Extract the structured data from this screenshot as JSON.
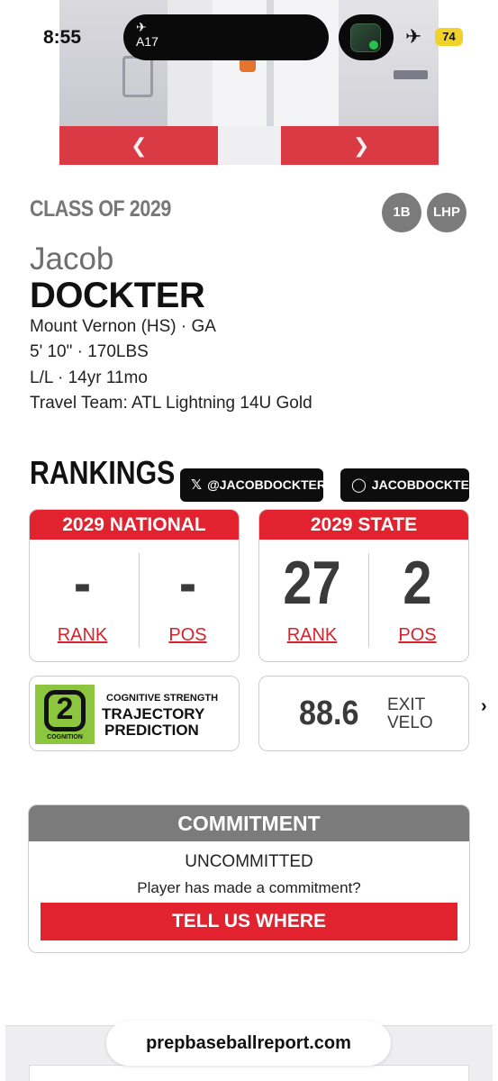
{
  "status_bar": {
    "time": "8:55",
    "live_activity_label": "A17",
    "battery": "74"
  },
  "profile": {
    "class_of": "CLASS OF 2029",
    "positions": [
      "1B",
      "LHP"
    ],
    "first_name": "Jacob",
    "last_name": "DOCKTER",
    "school": "Mount Vernon (HS) · GA",
    "size": "5' 10\" · 170LBS",
    "bats_throws_age": "L/L · 14yr 11mo",
    "travel_team": "Travel Team: ATL Lightning 14U Gold"
  },
  "rankings": {
    "title": "RANKINGS",
    "x_handle": "@JACOBDOCKTER_",
    "instagram_handle": "JACOBDOCKTER_",
    "national": {
      "header": "2029 NATIONAL",
      "rank": "-",
      "pos": "-",
      "rank_label": "RANK",
      "pos_label": "POS"
    },
    "state": {
      "header": "2029 STATE",
      "rank": "27",
      "pos": "2",
      "rank_label": "RANK",
      "pos_label": "POS"
    }
  },
  "cognition": {
    "logo_caption": "COGNITION",
    "small": "COGNITIVE STRENGTH",
    "line1": "TRAJECTORY",
    "line2": "PREDICTION"
  },
  "exit_velo": {
    "value": "88.6",
    "label_line1": "EXIT",
    "label_line2": "VELO"
  },
  "commitment": {
    "header": "COMMITMENT",
    "status": "UNCOMMITTED",
    "question": "Player has made a commitment?",
    "button": "TELL US WHERE"
  },
  "browser": {
    "url": "prepbaseballreport.com"
  },
  "colors": {
    "brand_red": "#e2232f",
    "header_gray": "#7b7b7b",
    "cognition_green": "#8cc63e"
  }
}
